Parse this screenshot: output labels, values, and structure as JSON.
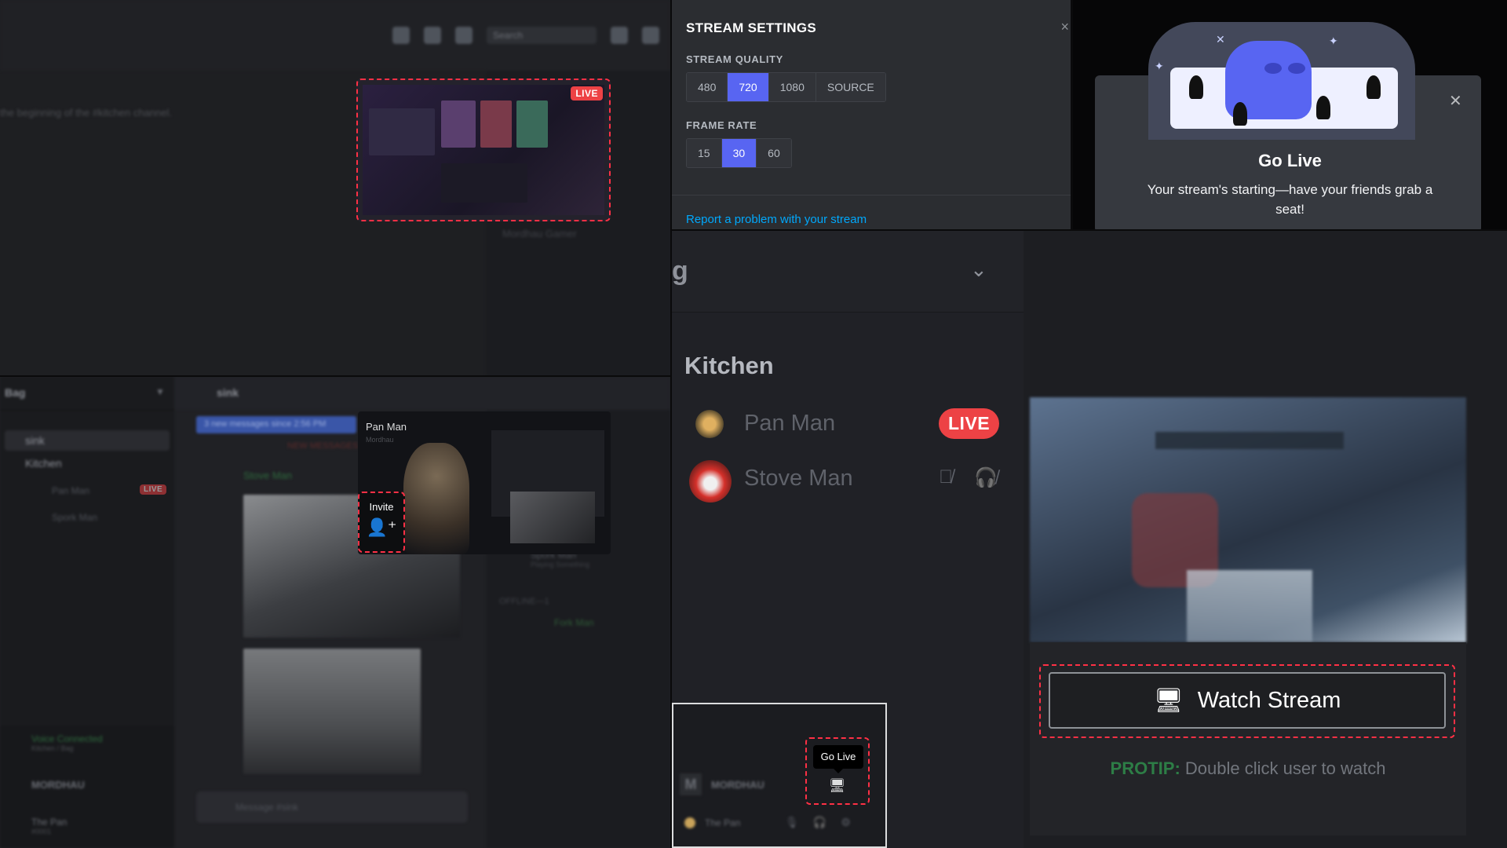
{
  "top_left": {
    "search_placeholder": "Search",
    "welcome_text": "the beginning of the #kitchen channel.",
    "member_text": "Mordhau Gamer",
    "live_badge": "LIVE"
  },
  "stream_settings": {
    "title": "STREAM SETTINGS",
    "quality_label": "STREAM QUALITY",
    "quality_options": [
      "480",
      "720",
      "1080",
      "SOURCE"
    ],
    "quality_selected": "720",
    "framerate_label": "FRAME RATE",
    "framerate_options": [
      "15",
      "30",
      "60"
    ],
    "framerate_selected": "30",
    "report_link": "Report a problem with your stream",
    "close_icon": "close-icon"
  },
  "go_live_popup": {
    "title": "Go Live",
    "description": "Your stream's starting—have your friends grab a seat!",
    "close_icon": "close-icon"
  },
  "discord_main": {
    "guild_name": "Bag",
    "channel_sink": "sink",
    "channel_kitchen": "Kitchen",
    "voice_users": [
      "Pan Man",
      "Spork Man"
    ],
    "live_badge": "LIVE",
    "voice_connected": "Voice Connected",
    "voice_sub": "Kitchen / Bag",
    "game": "MORDHAU",
    "user": "The Pan",
    "user_status": "#0001",
    "chan_header": "sink",
    "search_placeholder": "Search",
    "new_messages": "3 new messages since 2:56 PM",
    "new_messages_tag": "NEW MESSAGES",
    "poster": "Stove Man",
    "members": [
      "Spork Man",
      "OFFLINE—1",
      "Fork Man"
    ],
    "member_sub": "Playing Something",
    "message_placeholder": "Message #sink",
    "popup_name": "Pan Man",
    "popup_sub": "Mordhau",
    "invite_label": "Invite"
  },
  "zoom_voice": {
    "guild_fragment": "g",
    "channel": "Kitchen",
    "users": [
      "Pan Man",
      "Stove Man"
    ],
    "live_badge": "LIVE",
    "watch_button": "Watch Stream",
    "protip_label": "PROTIP:",
    "protip_text": " Double click user to watch"
  },
  "go_live_bar": {
    "game": "MORDHAU",
    "user": "The Pan",
    "tooltip": "Go Live"
  },
  "colors": {
    "blurple": "#5865f2",
    "live_red": "#ed4245",
    "link_blue": "#00a8fc",
    "protip_green": "#2d7d46",
    "highlight_dash": "#ff3045"
  }
}
